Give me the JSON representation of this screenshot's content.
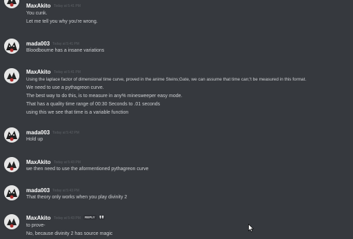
{
  "colors": {
    "background": "#36393e",
    "author": "#ffffff",
    "text": "#cfd1d4",
    "timestamp": "#5f6368"
  },
  "messages": [
    {
      "author": "MaxAkito",
      "timestamp": "Today at 5:41 PM",
      "lines": [
        "You cunk.",
        "Let me tell you why you're wrong."
      ]
    },
    {
      "author": "mada003",
      "timestamp": "Today at 5:41 PM",
      "lines": [
        "Bloodbourne has a insane variations"
      ]
    },
    {
      "author": "MaxAkito",
      "timestamp": "Today at 5:41 PM",
      "lines": [
        "Using the laplace factor of dimensional time curve, proved in the anime Steins;Gate, we can assume that time can;'t be measured in this format.",
        "We need to use a pythagreon curve.",
        "The best way to do this, is to measure in any% minesweeper easy mode.",
        "That has a quality time range of 00:30 Seconds to .01 seconds",
        "using this we see that time is a variable function"
      ]
    },
    {
      "author": "mada003",
      "timestamp": "Today at 5:42 PM",
      "lines": [
        "Hold up"
      ]
    },
    {
      "author": "MaxAkito",
      "timestamp": "Today at 5:43 PM",
      "lines": [
        "we then need to use the aformentioned pythagreon curve"
      ]
    },
    {
      "author": "mada003",
      "timestamp": "Today at 5:43 PM",
      "lines": [
        "That theory only works when you play divinity 2"
      ]
    },
    {
      "author": "MaxAkito",
      "timestamp": "Today at 5:43 PM",
      "reply_label": "REPLY",
      "lines": [
        "to prove-",
        "No, because divinity 2 has source magic"
      ]
    }
  ]
}
